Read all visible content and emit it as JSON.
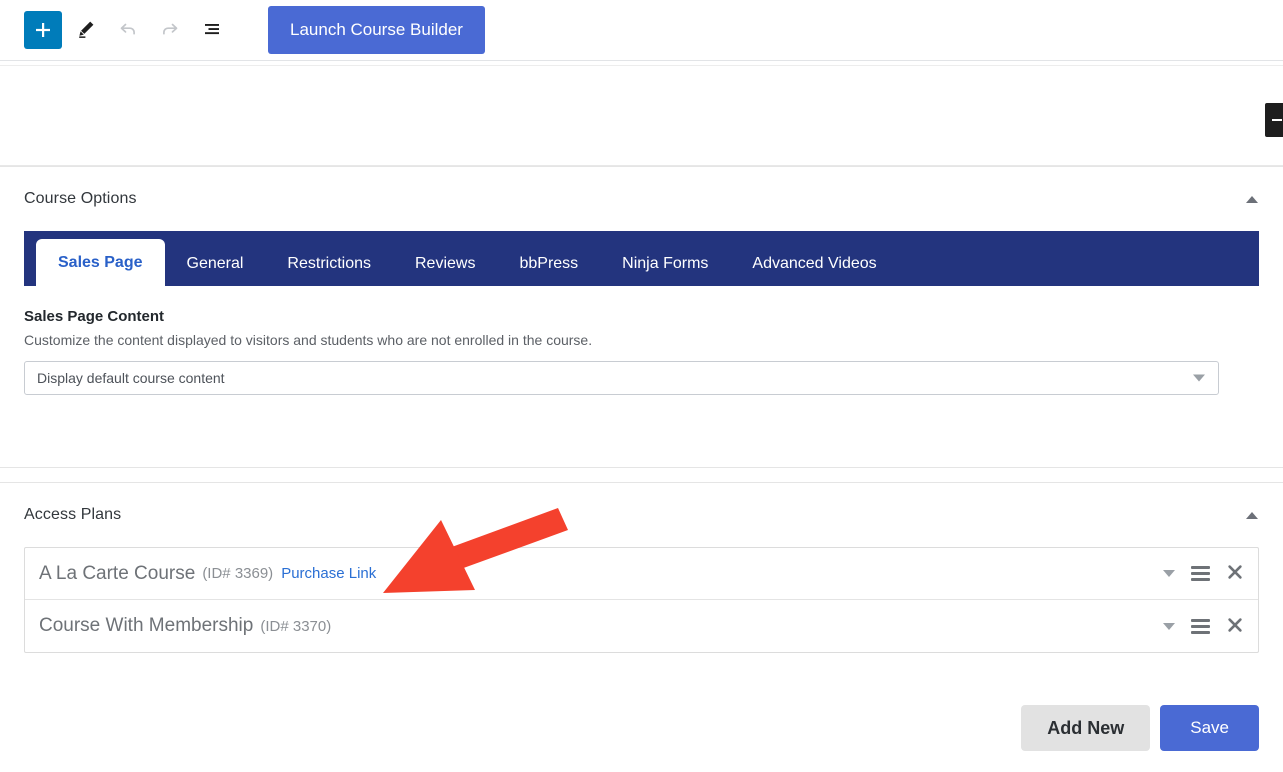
{
  "toolbar": {
    "add_block_label": "+",
    "add_block_icon": "plus-icon",
    "edit_icon": "pencil-icon",
    "undo_icon": "undo-icon",
    "redo_icon": "redo-icon",
    "outline_icon": "document-outline-icon",
    "launch_button_label": "Launch Course Builder",
    "launch_button_color": "#4a6ad4",
    "add_block_color": "#007cba"
  },
  "sidebar_handle": {
    "icon": "collapse-sidebar-icon"
  },
  "course_options": {
    "title": "Course Options",
    "collapse_icon": "caret-up-icon",
    "tabs": [
      {
        "label": "Sales Page",
        "active": true
      },
      {
        "label": "General",
        "active": false
      },
      {
        "label": "Restrictions",
        "active": false
      },
      {
        "label": "Reviews",
        "active": false
      },
      {
        "label": "bbPress",
        "active": false
      },
      {
        "label": "Ninja Forms",
        "active": false
      },
      {
        "label": "Advanced Videos",
        "active": false
      }
    ],
    "tabs_background": "#23347e",
    "active_tab_color": "#2960c8",
    "sales_page": {
      "heading": "Sales Page Content",
      "description": "Customize the content displayed to visitors and students who are not enrolled in the course.",
      "select_value": "Display default course content",
      "select_caret_icon": "caret-down-icon"
    }
  },
  "access_plans": {
    "title": "Access Plans",
    "collapse_icon": "caret-up-icon",
    "plans": [
      {
        "name": "A La Carte Course",
        "id": "(ID# 3369)",
        "link_label": "Purchase Link",
        "expand_icon": "caret-down-icon",
        "drag_icon": "drag-handle-icon",
        "delete_icon": "close-icon"
      },
      {
        "name": "Course With Membership",
        "id": "(ID# 3370)",
        "link_label": "",
        "expand_icon": "caret-down-icon",
        "drag_icon": "drag-handle-icon",
        "delete_icon": "close-icon"
      }
    ],
    "add_new_label": "Add New",
    "save_label": "Save",
    "save_color": "#4a6ad4"
  },
  "annotation": {
    "arrow_color": "#f4412d",
    "arrow_name": "red-annotation-arrow"
  }
}
